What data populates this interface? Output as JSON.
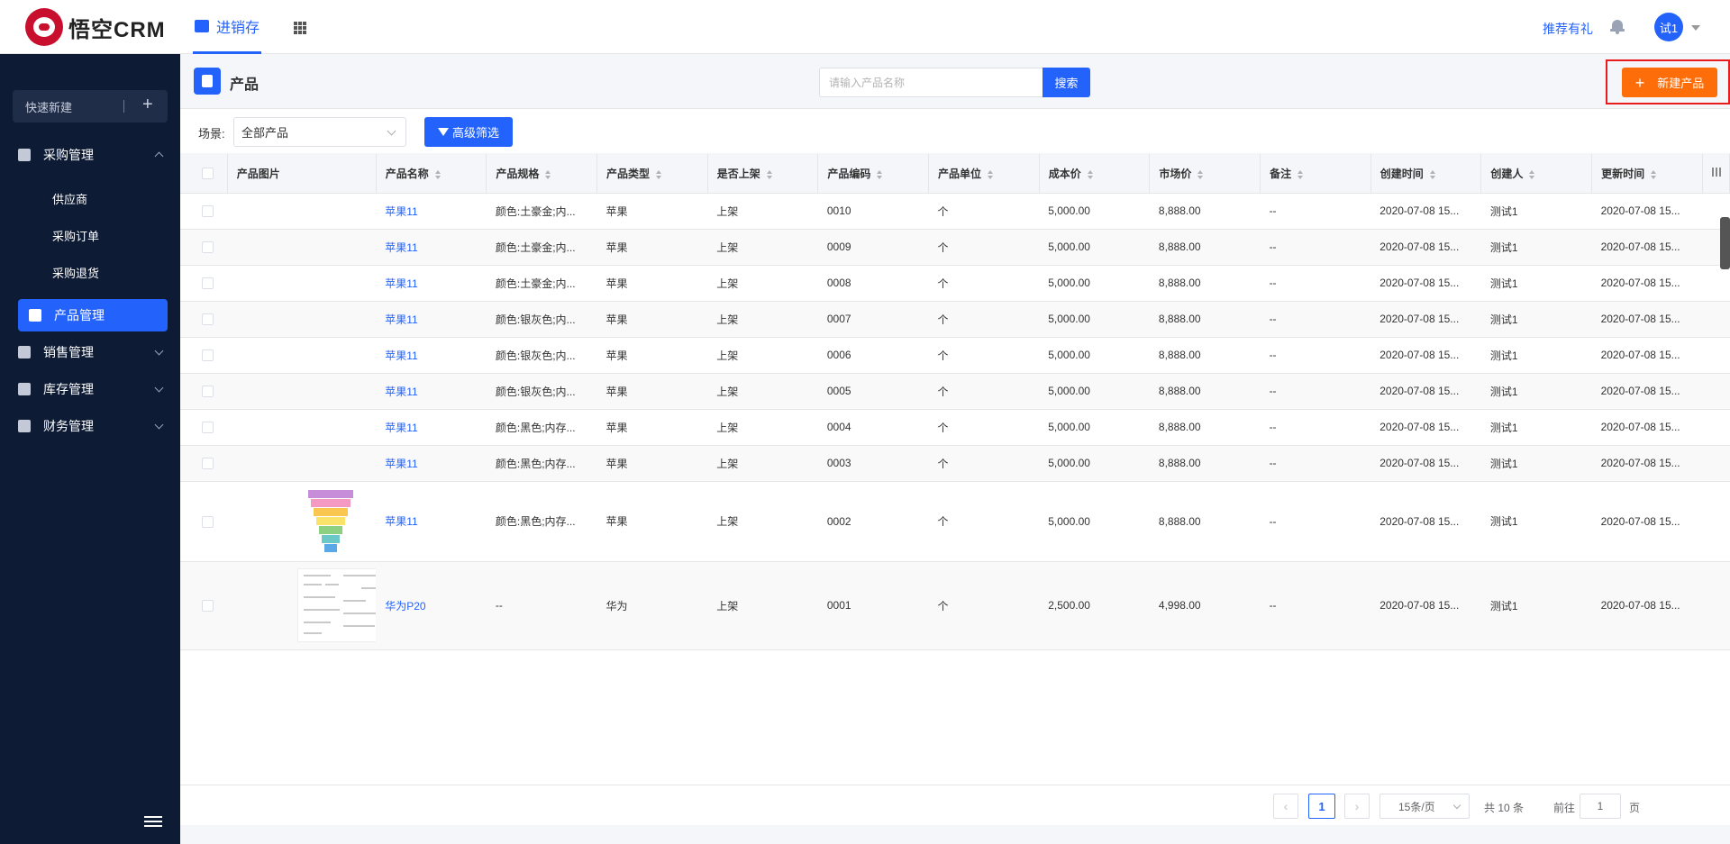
{
  "app": {
    "logo_text": "悟空CRM",
    "nav_tab": "进销存",
    "recommend": "推荐有礼",
    "avatar_text": "试1"
  },
  "sidebar": {
    "quick_new": "快速新建",
    "groups": [
      {
        "label": "采购管理",
        "children": [
          "供应商",
          "采购订单",
          "采购退货"
        ]
      },
      {
        "label": "产品管理"
      },
      {
        "label": "销售管理"
      },
      {
        "label": "库存管理"
      },
      {
        "label": "财务管理"
      }
    ]
  },
  "header": {
    "title": "产品",
    "search_placeholder": "请输入产品名称",
    "search_button": "搜索",
    "new_button": "新建产品"
  },
  "filter": {
    "scene_label": "场景:",
    "scene_value": "全部产品",
    "advanced_button": "高级筛选"
  },
  "table": {
    "columns": [
      "产品图片",
      "产品名称",
      "产品规格",
      "产品类型",
      "是否上架",
      "产品编码",
      "产品单位",
      "成本价",
      "市场价",
      "备注",
      "创建时间",
      "创建人",
      "更新时间"
    ],
    "rows": [
      [
        "",
        "苹果11",
        "颜色:土豪金;内...",
        "苹果",
        "上架",
        "0010",
        "个",
        "5,000.00",
        "8,888.00",
        "--",
        "2020-07-08 15...",
        "测试1",
        "2020-07-08 15..."
      ],
      [
        "",
        "苹果11",
        "颜色:土豪金;内...",
        "苹果",
        "上架",
        "0009",
        "个",
        "5,000.00",
        "8,888.00",
        "--",
        "2020-07-08 15...",
        "测试1",
        "2020-07-08 15..."
      ],
      [
        "",
        "苹果11",
        "颜色:土豪金;内...",
        "苹果",
        "上架",
        "0008",
        "个",
        "5,000.00",
        "8,888.00",
        "--",
        "2020-07-08 15...",
        "测试1",
        "2020-07-08 15..."
      ],
      [
        "",
        "苹果11",
        "颜色:银灰色;内...",
        "苹果",
        "上架",
        "0007",
        "个",
        "5,000.00",
        "8,888.00",
        "--",
        "2020-07-08 15...",
        "测试1",
        "2020-07-08 15..."
      ],
      [
        "",
        "苹果11",
        "颜色:银灰色;内...",
        "苹果",
        "上架",
        "0006",
        "个",
        "5,000.00",
        "8,888.00",
        "--",
        "2020-07-08 15...",
        "测试1",
        "2020-07-08 15..."
      ],
      [
        "",
        "苹果11",
        "颜色:银灰色;内...",
        "苹果",
        "上架",
        "0005",
        "个",
        "5,000.00",
        "8,888.00",
        "--",
        "2020-07-08 15...",
        "测试1",
        "2020-07-08 15..."
      ],
      [
        "",
        "苹果11",
        "颜色:黑色;内存...",
        "苹果",
        "上架",
        "0004",
        "个",
        "5,000.00",
        "8,888.00",
        "--",
        "2020-07-08 15...",
        "测试1",
        "2020-07-08 15..."
      ],
      [
        "",
        "苹果11",
        "颜色:黑色;内存...",
        "苹果",
        "上架",
        "0003",
        "个",
        "5,000.00",
        "8,888.00",
        "--",
        "2020-07-08 15...",
        "测试1",
        "2020-07-08 15..."
      ],
      [
        "funnel-thumbnail",
        "苹果11",
        "颜色:黑色;内存...",
        "苹果",
        "上架",
        "0002",
        "个",
        "5,000.00",
        "8,888.00",
        "--",
        "2020-07-08 15...",
        "测试1",
        "2020-07-08 15..."
      ],
      [
        "document-thumbnail",
        "华为P20",
        "--",
        "华为",
        "上架",
        "0001",
        "个",
        "2,500.00",
        "4,998.00",
        "--",
        "2020-07-08 15...",
        "测试1",
        "2020-07-08 15..."
      ]
    ]
  },
  "pagination": {
    "current": "1",
    "page_size": "15条/页",
    "total": "共 10 条",
    "goto_label": "前往",
    "goto_value": "1",
    "page_label": "页"
  },
  "colors": {
    "primary": "#2362fb",
    "accent": "#fd6e0b",
    "sidebar": "#0d1b35",
    "highlight": "#e81c1c"
  }
}
